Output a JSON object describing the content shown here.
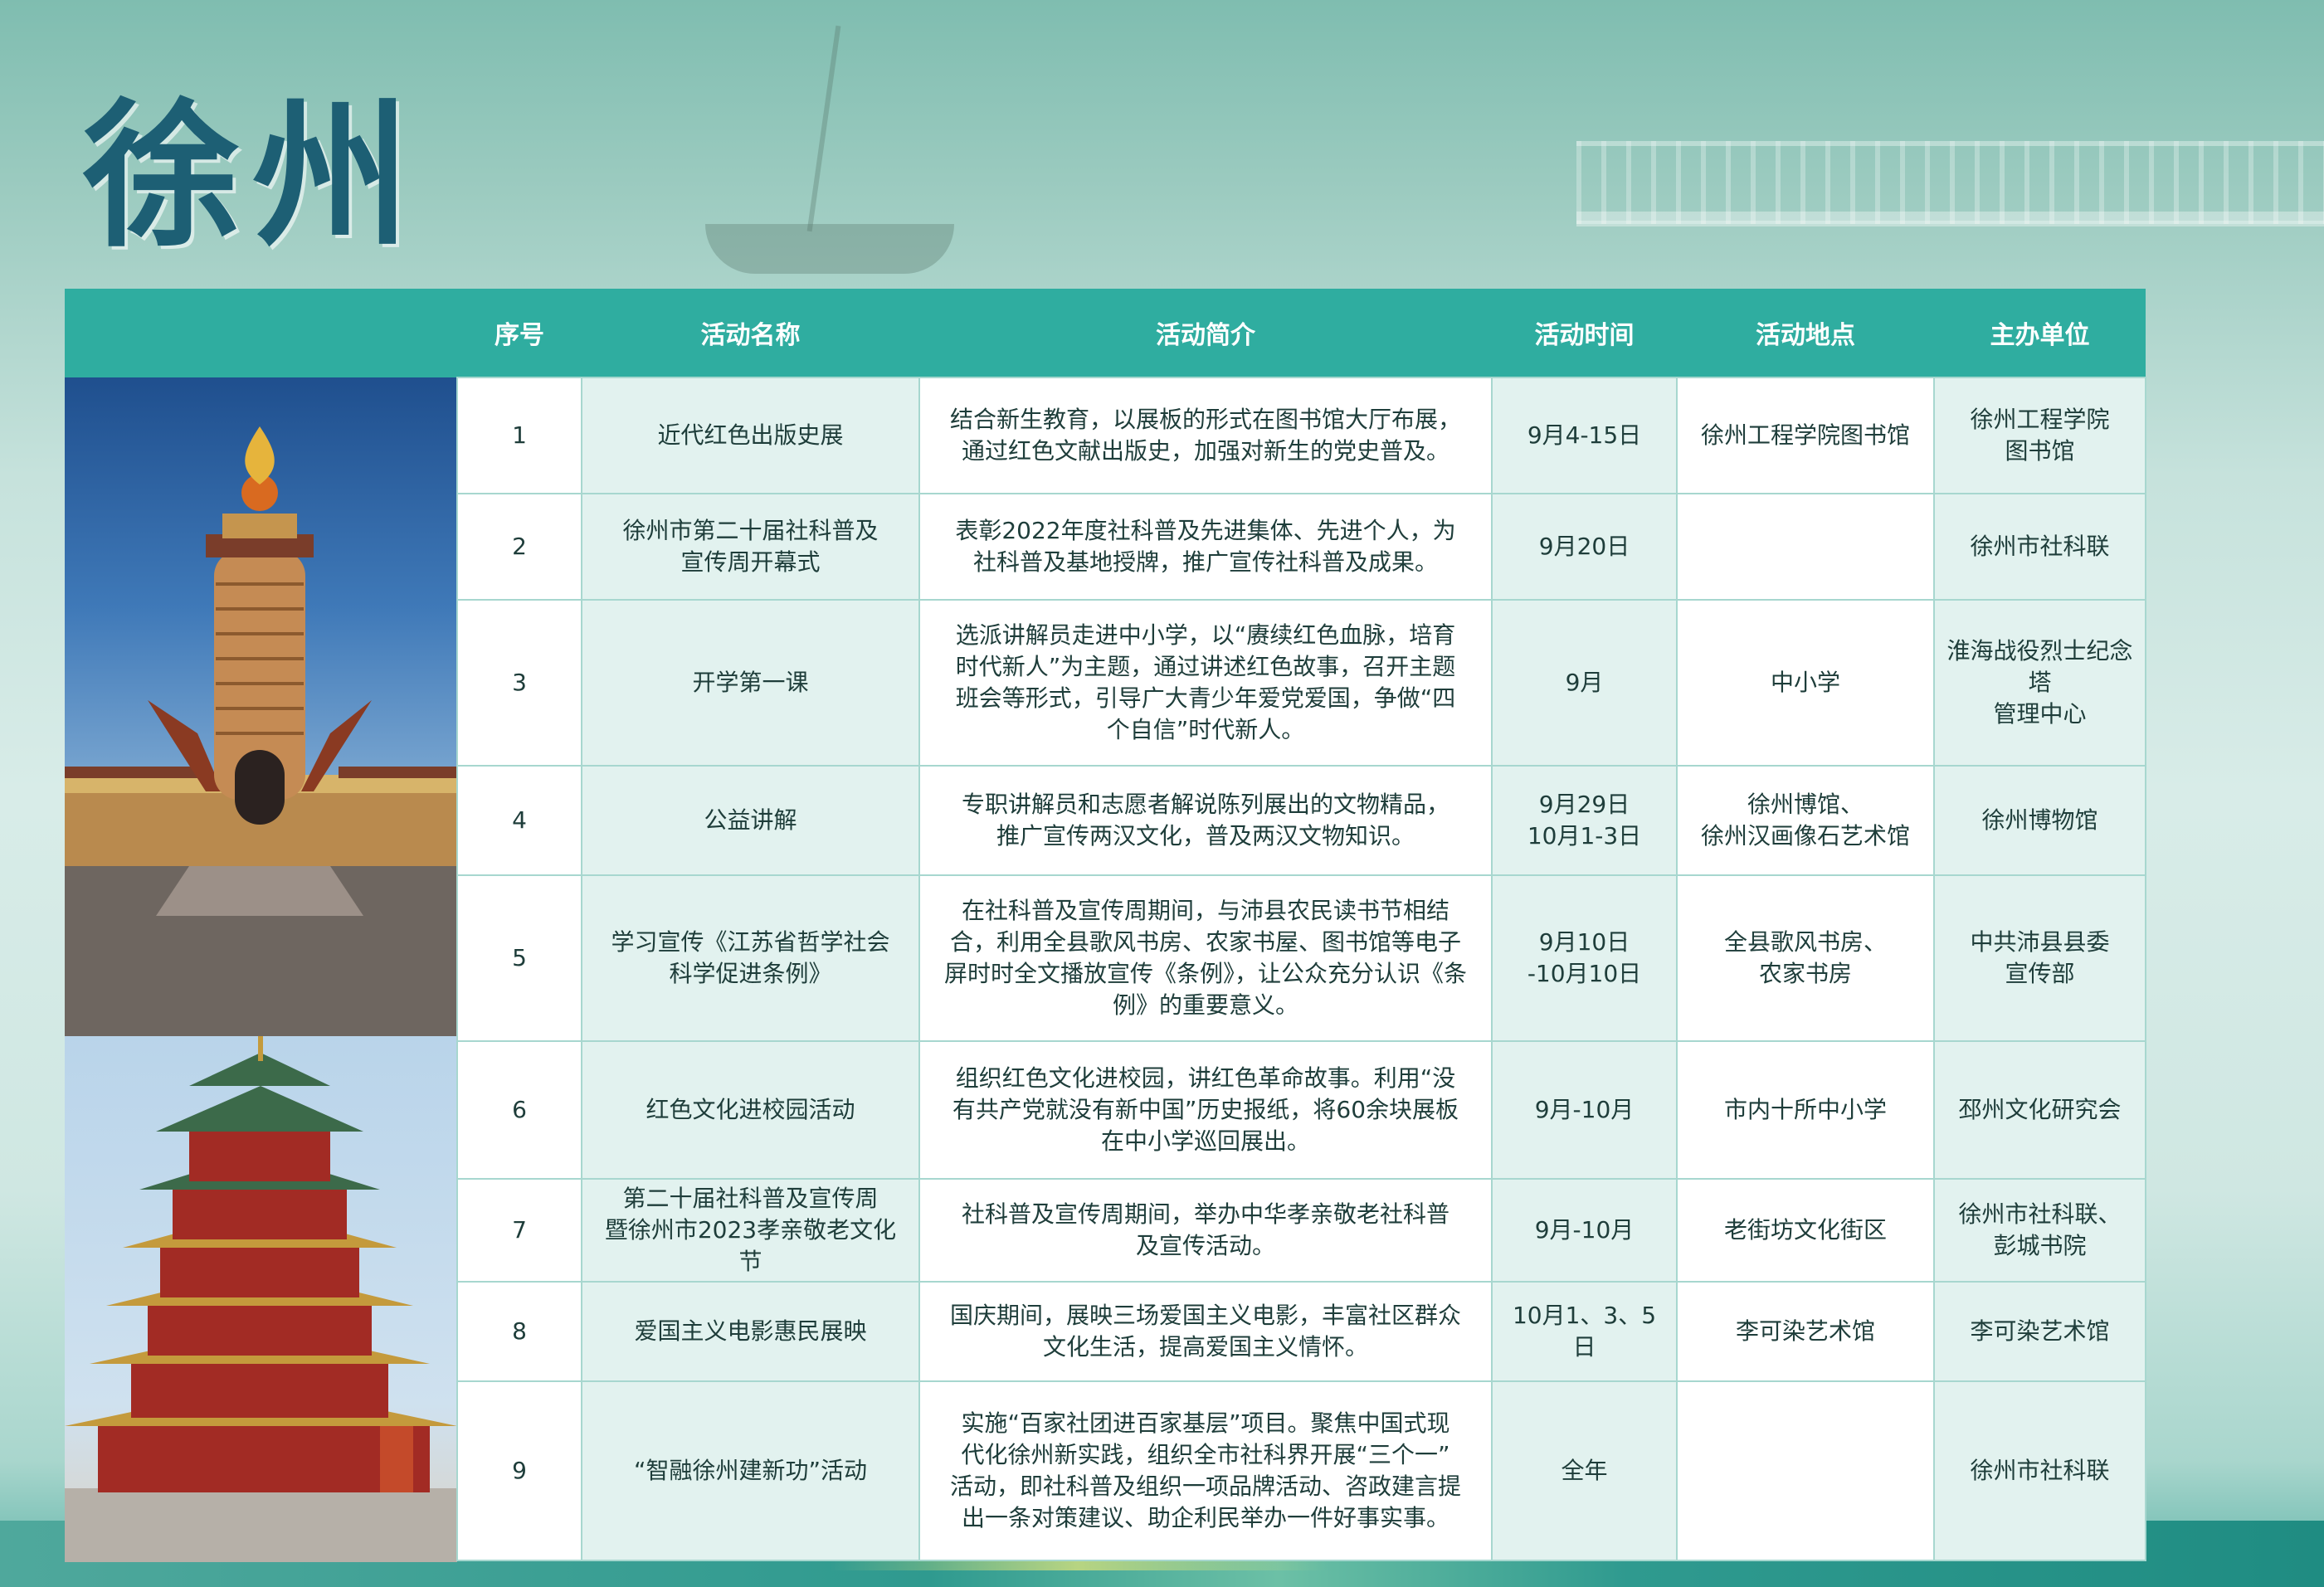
{
  "page": {
    "title": "徐州"
  },
  "table": {
    "headers": {
      "no": "序号",
      "name": "活动名称",
      "desc": "活动简介",
      "time": "活动时间",
      "place": "活动地点",
      "org": "主办单位"
    },
    "rows": [
      {
        "no": "1",
        "name": "近代红色出版史展",
        "desc": "结合新生教育，以展板的形式在图书馆大厅布展，\n通过红色文献出版史，加强对新生的党史普及。",
        "time": "9月4-15日",
        "place": "徐州工程学院图书馆",
        "org": "徐州工程学院\n图书馆"
      },
      {
        "no": "2",
        "name": "徐州市第二十届社科普及\n宣传周开幕式",
        "desc": "表彰2022年度社科普及先进集体、先进个人，为\n社科普及基地授牌，推广宣传社科普及成果。",
        "time": "9月20日",
        "place": "",
        "org": "徐州市社科联"
      },
      {
        "no": "3",
        "name": "开学第一课",
        "desc": "选派讲解员走进中小学，以“赓续红色血脉，培育\n时代新人”为主题，通过讲述红色故事，召开主题\n班会等形式，引导广大青少年爱党爱国，争做“四\n个自信”时代新人。",
        "time": "9月",
        "place": "中小学",
        "org": "淮海战役烈士纪念塔\n管理中心"
      },
      {
        "no": "4",
        "name": "公益讲解",
        "desc": "专职讲解员和志愿者解说陈列展出的文物精品，\n推广宣传两汉文化，普及两汉文物知识。",
        "time": "9月29日\n10月1-3日",
        "place": "徐州博馆、\n徐州汉画像石艺术馆",
        "org": "徐州博物馆"
      },
      {
        "no": "5",
        "name": "学习宣传《江苏省哲学社会\n科学促进条例》",
        "desc": "在社科普及宣传周期间，与沛县农民读书节相结\n合，利用全县歌风书房、农家书屋、图书馆等电子\n屏时时全文播放宣传《条例》，让公众充分认识《条\n例》的重要意义。",
        "time": "9月10日\n-10月10日",
        "place": "全县歌风书房、\n农家书房",
        "org": "中共沛县县委\n宣传部"
      },
      {
        "no": "6",
        "name": "红色文化进校园活动",
        "desc": "组织红色文化进校园，讲红色革命故事。利用“没\n有共产党就没有新中国”历史报纸，将60余块展板\n在中小学巡回展出。",
        "time": "9月-10月",
        "place": "市内十所中小学",
        "org": "邳州文化研究会"
      },
      {
        "no": "7",
        "name": "第二十届社科普及宣传周\n暨徐州市2023孝亲敬老文化节",
        "desc": "社科普及宣传周期间，举办中华孝亲敬老社科普\n及宣传活动。",
        "time": "9月-10月",
        "place": "老街坊文化街区",
        "org": "徐州市社科联、\n彭城书院"
      },
      {
        "no": "8",
        "name": "爱国主义电影惠民展映",
        "desc": "国庆期间，展映三场爱国主义电影，丰富社区群众\n文化生活，提高爱国主义情怀。",
        "time": "10月1、3、5日",
        "place": "李可染艺术馆",
        "org": "李可染艺术馆"
      },
      {
        "no": "9",
        "name": "“智融徐州建新功”活动",
        "desc": "实施“百家社团进百家基层”项目。聚焦中国式现\n代化徐州新实践，组织全市社科界开展“三个一”\n活动，即社科普及组织一项品牌活动、咨政建言提\n出一条对策建议、助企利民举办一件好事实事。",
        "time": "全年",
        "place": "",
        "org": "徐州市社科联"
      }
    ]
  },
  "colors": {
    "header_bg": "#2fada0",
    "title": "#1d5f74",
    "cell_tint": "#e2f2ef",
    "border": "#a7d7cf"
  }
}
